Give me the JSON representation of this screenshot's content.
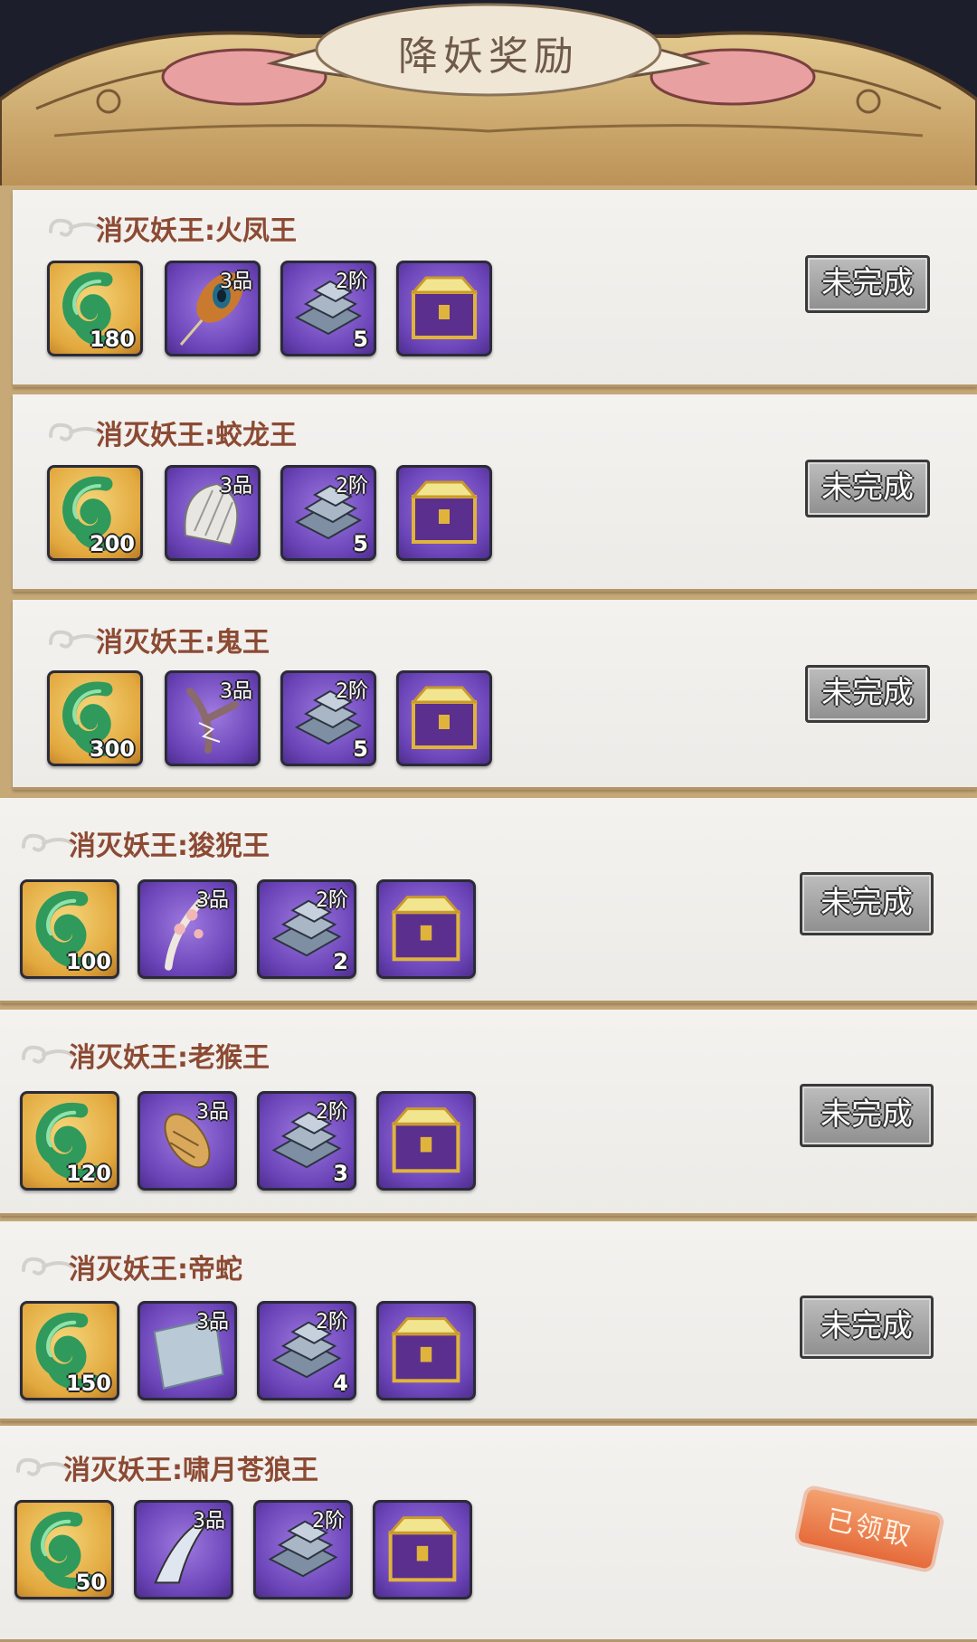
{
  "title": "降妖奖励",
  "colors": {
    "panel_bg": "#c7a977",
    "title_text": "#8c4a33",
    "status_btn": "#9e9e9e",
    "claimed_stamp": "#e66a3a"
  },
  "rewards": [
    {
      "title": "消灭妖王:火凤王",
      "items": [
        {
          "icon": "jade-swirl-icon",
          "count": "180",
          "badge": ""
        },
        {
          "icon": "peacock-feather-icon",
          "count": "",
          "badge": "3品"
        },
        {
          "icon": "iron-ingot-icon",
          "count": "5",
          "badge": "2阶"
        },
        {
          "icon": "treasure-chest-icon",
          "count": "",
          "badge": ""
        }
      ],
      "status": "未完成"
    },
    {
      "title": "消灭妖王:蛟龙王",
      "items": [
        {
          "icon": "jade-swirl-icon",
          "count": "200",
          "badge": ""
        },
        {
          "icon": "scale-icon",
          "count": "",
          "badge": "3品"
        },
        {
          "icon": "iron-ingot-icon",
          "count": "5",
          "badge": "2阶"
        },
        {
          "icon": "treasure-chest-icon",
          "count": "",
          "badge": ""
        }
      ],
      "status": "未完成"
    },
    {
      "title": "消灭妖王:鬼王",
      "items": [
        {
          "icon": "jade-swirl-icon",
          "count": "300",
          "badge": ""
        },
        {
          "icon": "thunder-branch-icon",
          "count": "",
          "badge": "3品"
        },
        {
          "icon": "iron-ingot-icon",
          "count": "5",
          "badge": "2阶"
        },
        {
          "icon": "treasure-chest-icon",
          "count": "",
          "badge": ""
        }
      ],
      "status": "未完成"
    },
    {
      "title": "消灭妖王:狻猊王",
      "items": [
        {
          "icon": "jade-swirl-icon",
          "count": "100",
          "badge": ""
        },
        {
          "icon": "blossom-branch-icon",
          "count": "",
          "badge": "3品"
        },
        {
          "icon": "iron-ingot-icon",
          "count": "2",
          "badge": "2阶"
        },
        {
          "icon": "treasure-chest-icon",
          "count": "",
          "badge": ""
        }
      ],
      "status": "未完成"
    },
    {
      "title": "消灭妖王:老猴王",
      "items": [
        {
          "icon": "jade-swirl-icon",
          "count": "120",
          "badge": ""
        },
        {
          "icon": "cocoon-icon",
          "count": "",
          "badge": "3品"
        },
        {
          "icon": "iron-ingot-icon",
          "count": "3",
          "badge": "2阶"
        },
        {
          "icon": "treasure-chest-icon",
          "count": "",
          "badge": ""
        }
      ],
      "status": "未完成"
    },
    {
      "title": "消灭妖王:帝蛇",
      "items": [
        {
          "icon": "jade-swirl-icon",
          "count": "150",
          "badge": ""
        },
        {
          "icon": "snake-skin-icon",
          "count": "",
          "badge": "3品"
        },
        {
          "icon": "iron-ingot-icon",
          "count": "4",
          "badge": "2阶"
        },
        {
          "icon": "treasure-chest-icon",
          "count": "",
          "badge": ""
        }
      ],
      "status": "未完成"
    },
    {
      "title": "消灭妖王:啸月苍狼王",
      "items": [
        {
          "icon": "jade-swirl-icon",
          "count": "50",
          "badge": ""
        },
        {
          "icon": "wolf-claw-icon",
          "count": "",
          "badge": "3品"
        },
        {
          "icon": "iron-ingot-icon",
          "count": "",
          "badge": "2阶"
        },
        {
          "icon": "treasure-chest-icon",
          "count": "",
          "badge": ""
        }
      ],
      "status": "已领取"
    }
  ]
}
